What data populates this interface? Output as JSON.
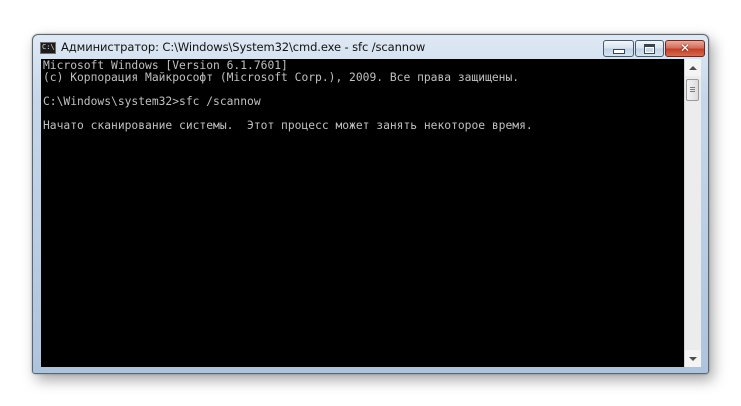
{
  "window": {
    "title": "Администратор: C:\\Windows\\System32\\cmd.exe - sfc  /scannow",
    "icon": "cmd-icon",
    "icon_label": "C:\\"
  },
  "controls": {
    "minimize": "minimize-icon",
    "maximize": "maximize-icon",
    "close": "close-icon",
    "close_glyph": "✕"
  },
  "console": {
    "lines": [
      "Microsoft Windows [Version 6.1.7601]",
      "(c) Корпорация Майкрософт (Microsoft Corp.), 2009. Все права защищены.",
      "",
      "C:\\Windows\\system32>sfc /scannow",
      "",
      "Начато сканирование системы.  Этот процесс может занять некоторое время."
    ],
    "text_color": "#c0c0c0",
    "background_color": "#000000"
  },
  "scrollbar": {
    "up_icon": "scroll-up-arrow-icon",
    "down_icon": "scroll-down-arrow-icon"
  }
}
